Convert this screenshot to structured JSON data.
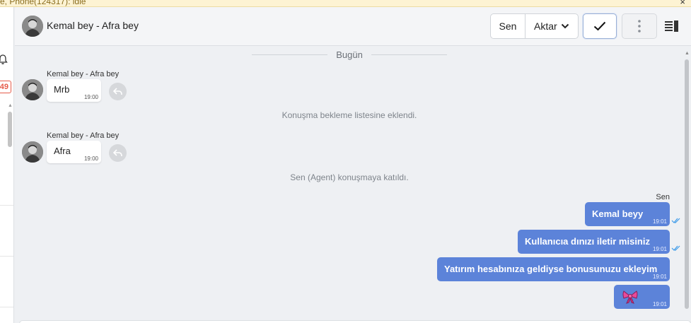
{
  "top_bar": {
    "status_text": "e, Phone(124317): idle",
    "close_glyph": "×"
  },
  "left_sidebar": {
    "badge_count": "49"
  },
  "header": {
    "title": "Kemal bey - Afra bey",
    "sen_button": "Sen",
    "aktar_button": "Aktar"
  },
  "chat": {
    "date_separator": "Bugün",
    "messages_in": [
      {
        "sender": "Kemal bey - Afra bey",
        "text": "Mrb",
        "time": "19:00"
      },
      {
        "sender": "Kemal bey - Afra bey",
        "text": "Afra",
        "time": "19:00"
      }
    ],
    "system_notes": [
      "Konuşma bekleme listesine eklendi.",
      "Sen (Agent) konuşmaya katıldı."
    ],
    "outgoing_sender": "Sen",
    "messages_out": [
      {
        "text": "Kemal beyy",
        "time": "19:01",
        "read": true
      },
      {
        "text": "Kullanıcıa dınızı iletir misiniz",
        "time": "19:01",
        "read": true
      },
      {
        "text": "Yatırım hesabınıza geldiyse bonusunuzu ekleyim",
        "time": "19:01",
        "read": false
      },
      {
        "text": "",
        "emoji": "ribbon-bow",
        "time": "19:01",
        "read": false
      }
    ]
  },
  "colors": {
    "outgoing_bubble": "#5c83d9",
    "read_tick": "#3d9be9",
    "badge": "#e55b4a",
    "background": "#eef0f3"
  }
}
